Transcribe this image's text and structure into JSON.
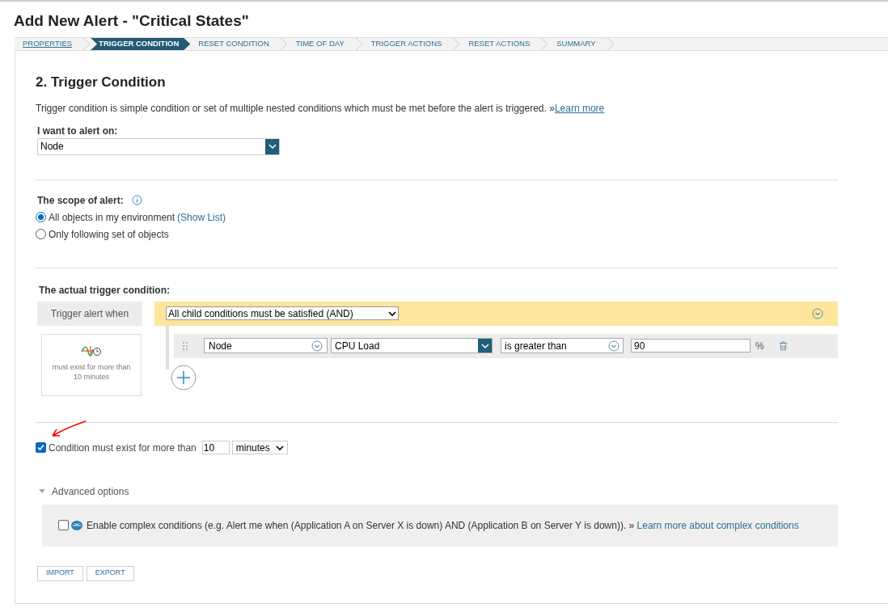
{
  "page_title": "Add New Alert - \"Critical States\"",
  "steps": [
    {
      "label": "PROPERTIES",
      "selected": false,
      "kind": "link"
    },
    {
      "label": "TRIGGER CONDITION",
      "selected": true,
      "kind": "step"
    },
    {
      "label": "RESET CONDITION",
      "selected": false,
      "kind": "step"
    },
    {
      "label": "TIME OF DAY",
      "selected": false,
      "kind": "step"
    },
    {
      "label": "TRIGGER ACTIONS",
      "selected": false,
      "kind": "step"
    },
    {
      "label": "RESET ACTIONS",
      "selected": false,
      "kind": "step"
    },
    {
      "label": "SUMMARY",
      "selected": false,
      "kind": "step"
    }
  ],
  "section_title": "2. Trigger Condition",
  "intro": {
    "text": "Trigger condition is simple condition or set of multiple nested conditions which must be met before the alert is triggered. »",
    "link": "Learn more"
  },
  "alert_on": {
    "label": "I want to alert on:",
    "value": "Node"
  },
  "scope": {
    "label": "The scope of alert:",
    "options": [
      {
        "label": "All objects in my environment",
        "link": "(Show List)",
        "selected": true
      },
      {
        "label": "Only following set of objects",
        "selected": false
      }
    ]
  },
  "trigger": {
    "label": "The actual trigger condition:",
    "when_label": "Trigger alert when",
    "group_value": "All child conditions must be satisfied (AND)",
    "summary": "must exist for more than 10 minutes",
    "condition": {
      "object": "Node",
      "field": "CPU Load",
      "operator": "is greater than",
      "value": "90",
      "unit": "%"
    }
  },
  "duration": {
    "checked": true,
    "label": "Condition must exist for more than",
    "value": "10",
    "unit": "minutes"
  },
  "advanced": {
    "label": "Advanced options",
    "expanded": true,
    "complex": {
      "checked": false,
      "text": "Enable complex conditions (e.g. Alert me when (Application A on Server X is down) AND (Application B on Server Y is down)). »",
      "link": "Learn more about complex conditions"
    }
  },
  "buttons": [
    "IMPORT",
    "EXPORT"
  ]
}
